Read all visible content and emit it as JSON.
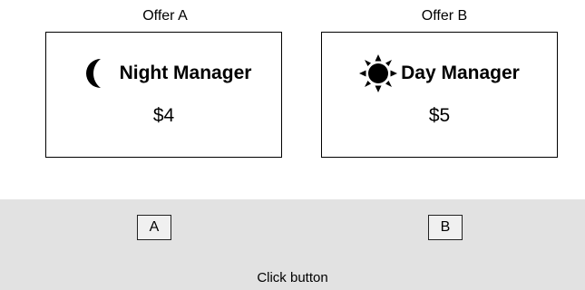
{
  "offers": [
    {
      "heading": "Offer A",
      "icon": "moon-icon",
      "title": "Night Manager",
      "price": "$4"
    },
    {
      "heading": "Offer B",
      "icon": "sun-icon",
      "title": "Day Manager",
      "price": "$5"
    }
  ],
  "buttons": {
    "a_label": "A",
    "b_label": "B"
  },
  "prompt": "Click button",
  "colors": {
    "background": "#ffffff",
    "button_area": "#e2e2e2",
    "border": "#000000"
  }
}
